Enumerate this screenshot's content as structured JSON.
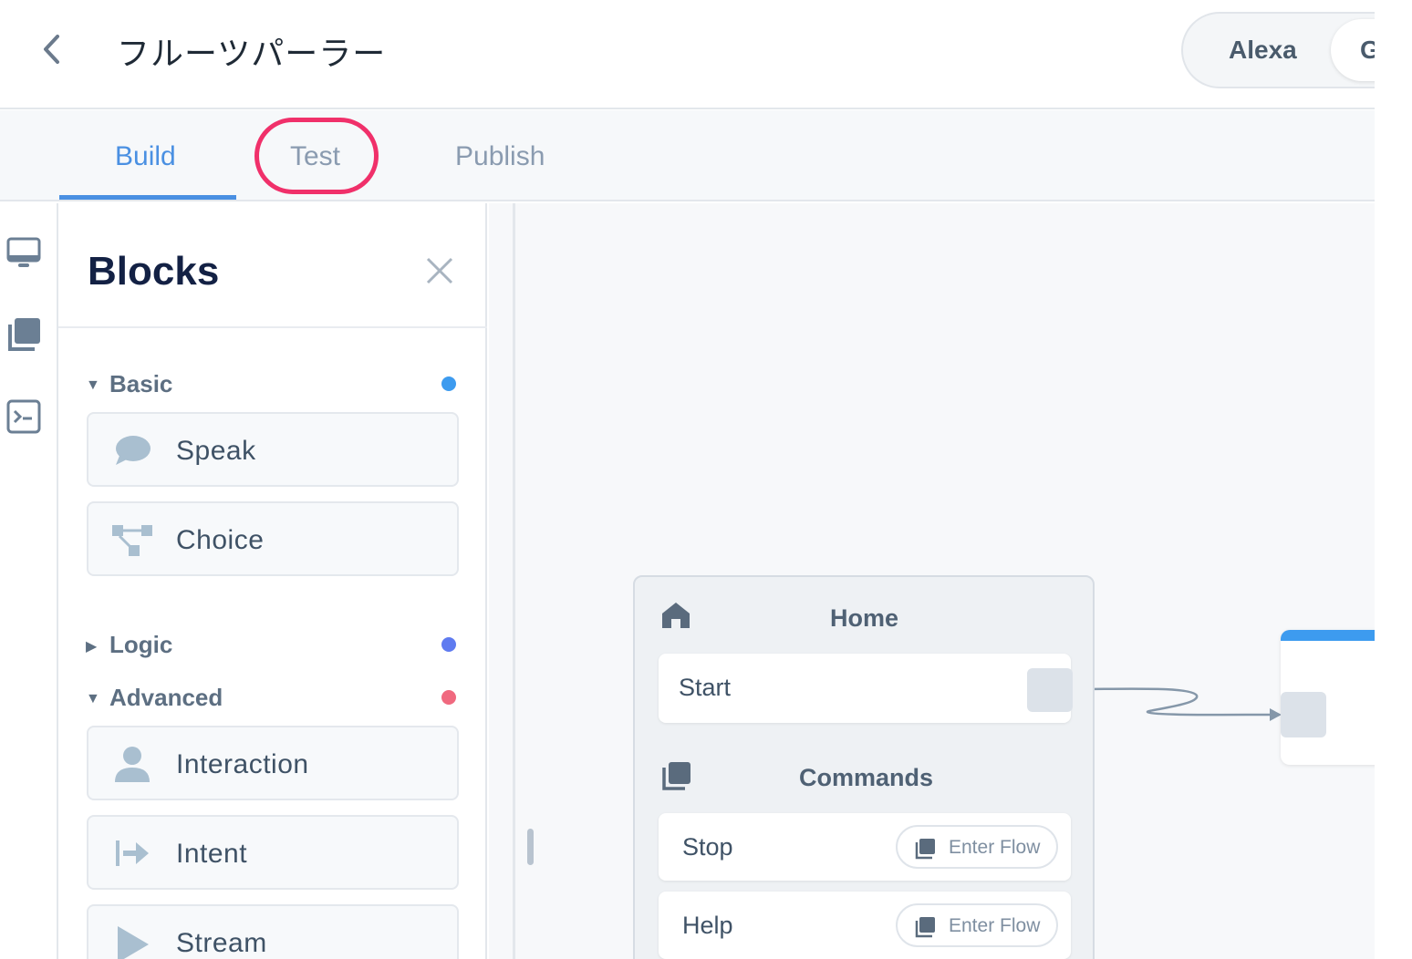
{
  "header": {
    "title": "フルーツパーラー",
    "platforms": [
      "Alexa",
      "G"
    ]
  },
  "tabs": [
    {
      "label": "Build",
      "active": true
    },
    {
      "label": "Test",
      "highlighted": true
    },
    {
      "label": "Publish"
    }
  ],
  "rail": {
    "icons": [
      "monitor-icon",
      "flows-icon",
      "terminal-icon"
    ]
  },
  "blocks_panel": {
    "title": "Blocks",
    "sections": [
      {
        "name": "Basic",
        "expanded": true,
        "color": "#3d9bef",
        "blocks": [
          "Speak",
          "Choice"
        ]
      },
      {
        "name": "Logic",
        "expanded": false,
        "color": "#5f7bf0"
      },
      {
        "name": "Advanced",
        "expanded": true,
        "color": "#f0697f",
        "blocks": [
          "Interaction",
          "Intent",
          "Stream"
        ]
      }
    ]
  },
  "canvas": {
    "home_node": {
      "title": "Home",
      "start_label": "Start",
      "commands_title": "Commands",
      "commands": [
        {
          "label": "Stop",
          "action": "Enter Flow"
        },
        {
          "label": "Help",
          "action": "Enter Flow"
        }
      ]
    }
  },
  "colors": {
    "accent": "#4a90e2",
    "highlight_ring": "#f0306a"
  }
}
